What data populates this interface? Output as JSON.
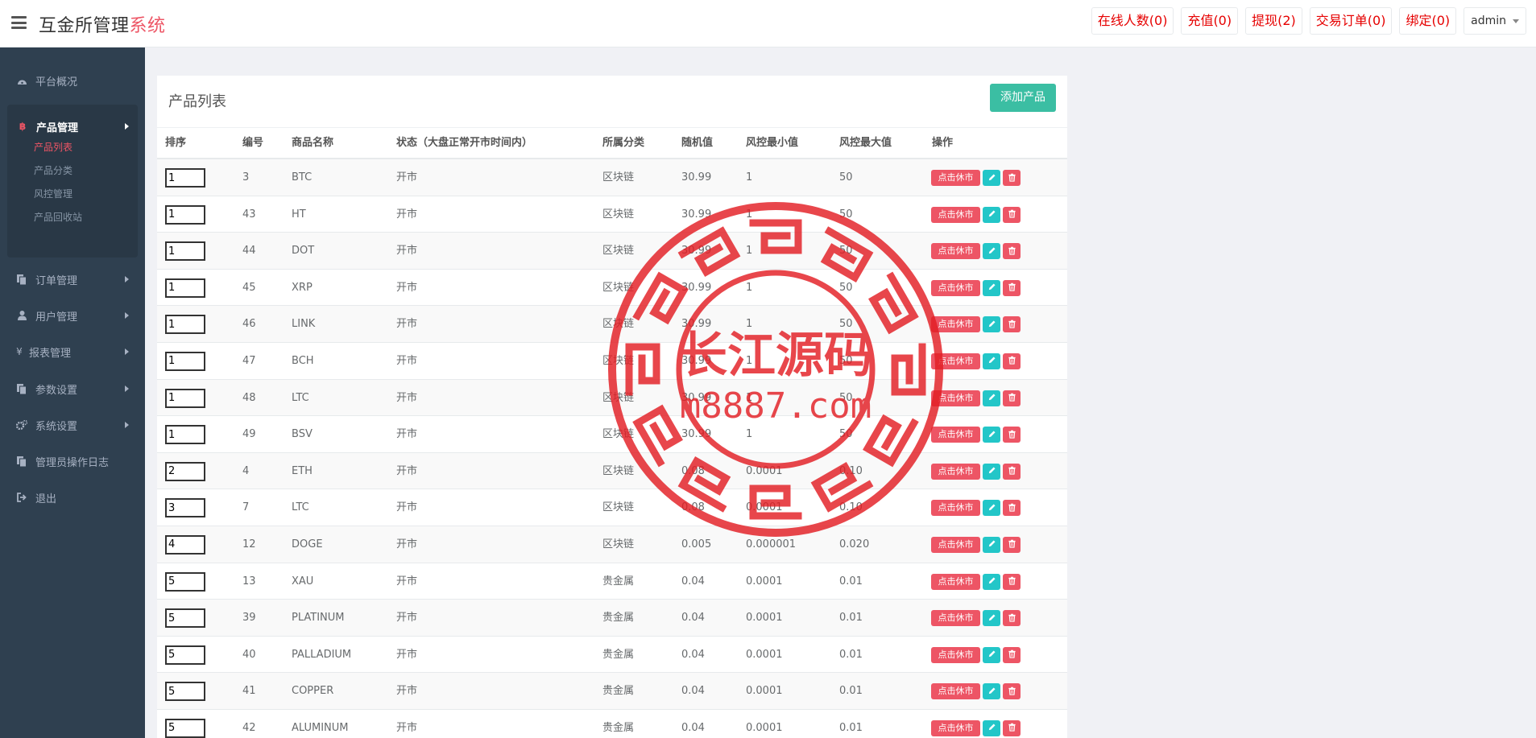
{
  "header": {
    "brand_main": "互金所管理",
    "brand_accent": "系统",
    "actions": [
      {
        "label": "在线人数(0)"
      },
      {
        "label": "充值(0)"
      },
      {
        "label": "提现(2)"
      },
      {
        "label": "交易订单(0)"
      },
      {
        "label": "绑定(0)"
      }
    ],
    "user": "admin"
  },
  "sidebar": {
    "items": [
      {
        "label": "平台概况",
        "icon": "dashboard-icon"
      },
      {
        "label": "产品管理",
        "icon": "bitcoin-icon"
      },
      {
        "label": "订单管理",
        "icon": "files-icon"
      },
      {
        "label": "用户管理",
        "icon": "user-icon"
      },
      {
        "label": "报表管理",
        "icon": "yen-icon"
      },
      {
        "label": "参数设置",
        "icon": "files-icon"
      },
      {
        "label": "系统设置",
        "icon": "gears-icon"
      },
      {
        "label": "管理员操作日志",
        "icon": "files-icon"
      },
      {
        "label": "退出",
        "icon": "sign-out-icon"
      }
    ],
    "submenu": [
      {
        "label": "产品列表"
      },
      {
        "label": "产品分类"
      },
      {
        "label": "风控管理"
      },
      {
        "label": "产品回收站"
      }
    ]
  },
  "panel": {
    "title": "产品列表",
    "add_label": "添加产品"
  },
  "table": {
    "columns": [
      "排序",
      "编号",
      "商品名称",
      "状态（大盘正常开市时间内）",
      "所属分类",
      "随机值",
      "风控最小值",
      "风控最大值",
      "操作"
    ],
    "action_label": "点击休市",
    "rows": [
      {
        "sort": "1",
        "id": "3",
        "name": "BTC",
        "status": "开市",
        "category": "区块链",
        "random": "30.99",
        "min": "1",
        "max": "50"
      },
      {
        "sort": "1",
        "id": "43",
        "name": "HT",
        "status": "开市",
        "category": "区块链",
        "random": "30.99",
        "min": "1",
        "max": "50"
      },
      {
        "sort": "1",
        "id": "44",
        "name": "DOT",
        "status": "开市",
        "category": "区块链",
        "random": "30.99",
        "min": "1",
        "max": "50"
      },
      {
        "sort": "1",
        "id": "45",
        "name": "XRP",
        "status": "开市",
        "category": "区块链",
        "random": "30.99",
        "min": "1",
        "max": "50"
      },
      {
        "sort": "1",
        "id": "46",
        "name": "LINK",
        "status": "开市",
        "category": "区块链",
        "random": "30.99",
        "min": "1",
        "max": "50"
      },
      {
        "sort": "1",
        "id": "47",
        "name": "BCH",
        "status": "开市",
        "category": "区块链",
        "random": "30.99",
        "min": "1",
        "max": "50"
      },
      {
        "sort": "1",
        "id": "48",
        "name": "LTC",
        "status": "开市",
        "category": "区块链",
        "random": "30.99",
        "min": "1",
        "max": "50"
      },
      {
        "sort": "1",
        "id": "49",
        "name": "BSV",
        "status": "开市",
        "category": "区块链",
        "random": "30.99",
        "min": "1",
        "max": "50"
      },
      {
        "sort": "2",
        "id": "4",
        "name": "ETH",
        "status": "开市",
        "category": "区块链",
        "random": "0.08",
        "min": "0.0001",
        "max": "0.10"
      },
      {
        "sort": "3",
        "id": "7",
        "name": "LTC",
        "status": "开市",
        "category": "区块链",
        "random": "0.08",
        "min": "0.0001",
        "max": "0.10"
      },
      {
        "sort": "4",
        "id": "12",
        "name": "DOGE",
        "status": "开市",
        "category": "区块链",
        "random": "0.005",
        "min": "0.000001",
        "max": "0.020"
      },
      {
        "sort": "5",
        "id": "13",
        "name": "XAU",
        "status": "开市",
        "category": "贵金属",
        "random": "0.04",
        "min": "0.0001",
        "max": "0.01"
      },
      {
        "sort": "5",
        "id": "39",
        "name": "PLATINUM",
        "status": "开市",
        "category": "贵金属",
        "random": "0.04",
        "min": "0.0001",
        "max": "0.01"
      },
      {
        "sort": "5",
        "id": "40",
        "name": "PALLADIUM",
        "status": "开市",
        "category": "贵金属",
        "random": "0.04",
        "min": "0.0001",
        "max": "0.01"
      },
      {
        "sort": "5",
        "id": "41",
        "name": "COPPER",
        "status": "开市",
        "category": "贵金属",
        "random": "0.04",
        "min": "0.0001",
        "max": "0.01"
      },
      {
        "sort": "5",
        "id": "42",
        "name": "ALUMINUM",
        "status": "开市",
        "category": "贵金属",
        "random": "0.04",
        "min": "0.0001",
        "max": "0.01"
      }
    ]
  },
  "watermark": {
    "line1": "长江源码",
    "line2": "m8887.com",
    "color": "#e31e24"
  }
}
